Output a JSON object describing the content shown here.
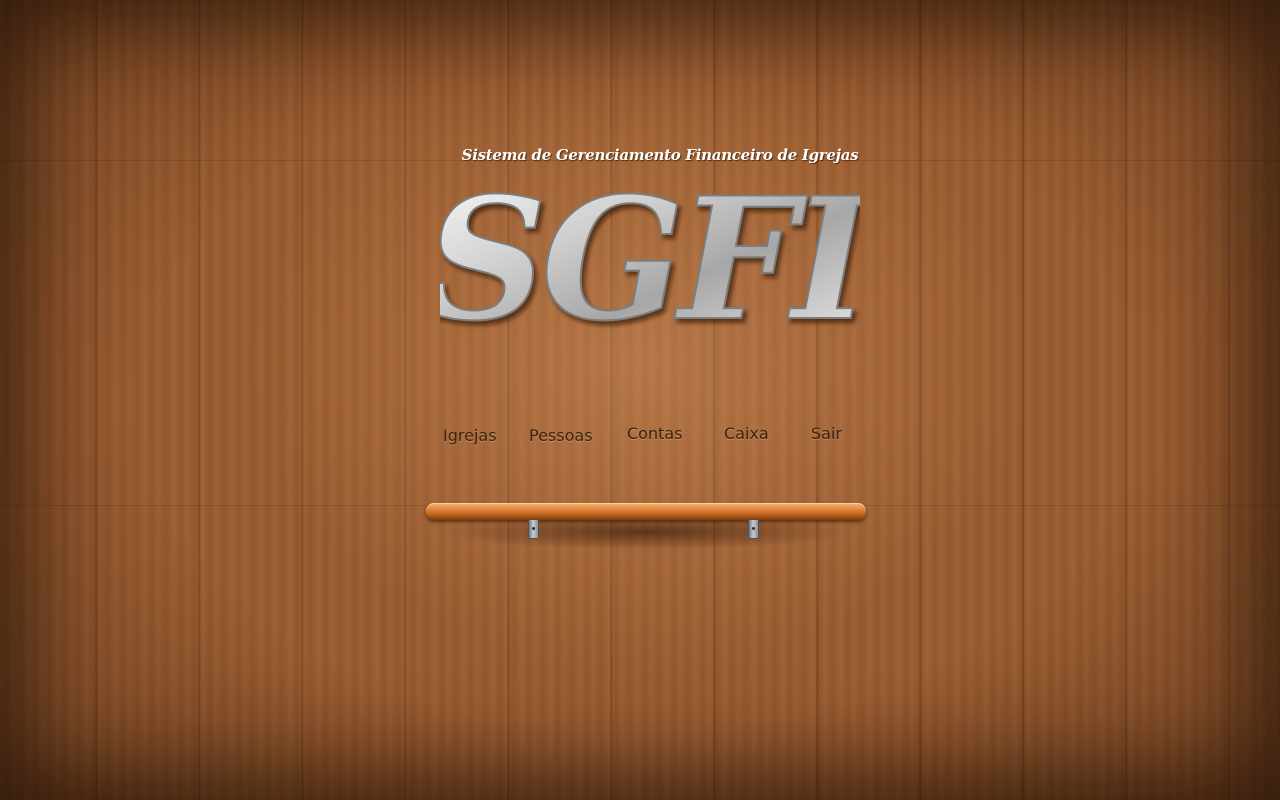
{
  "app": {
    "subtitle": "Sistema de Gerenciamento Financeiro de Igrejas",
    "logo_text": "SGFI"
  },
  "nav": {
    "items": [
      {
        "id": "igrejas",
        "label": "Igrejas"
      },
      {
        "id": "pessoas",
        "label": "Pessoas"
      },
      {
        "id": "contas",
        "label": "Contas"
      },
      {
        "id": "caixa",
        "label": "Caixa"
      },
      {
        "id": "sair",
        "label": "Sair"
      }
    ]
  },
  "colors": {
    "wood": "#9b5c30",
    "nav_text": "#3a2312",
    "logo_silver": "#d9d9d9",
    "shelf": "#e08a3c"
  }
}
